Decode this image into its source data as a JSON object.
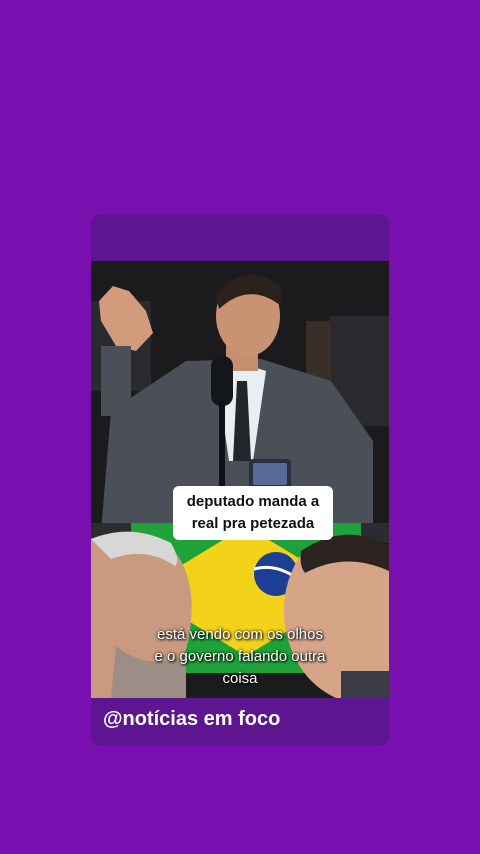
{
  "post": {
    "caption": "deputado manda a\nreal pra petezada",
    "subtitle": "está vendo com os olhos\ne o governo falando outra\ncoisa",
    "handle": "@notícias em foco"
  },
  "colors": {
    "background": "#7a0fb0",
    "card": "#5e1590",
    "flag_green": "#1fa23a",
    "flag_yellow": "#f3d21a",
    "flag_blue": "#1c3f94"
  },
  "icons": {
    "microphone": "microphone-icon",
    "phone": "phone-icon",
    "flag": "brazil-flag-icon"
  }
}
